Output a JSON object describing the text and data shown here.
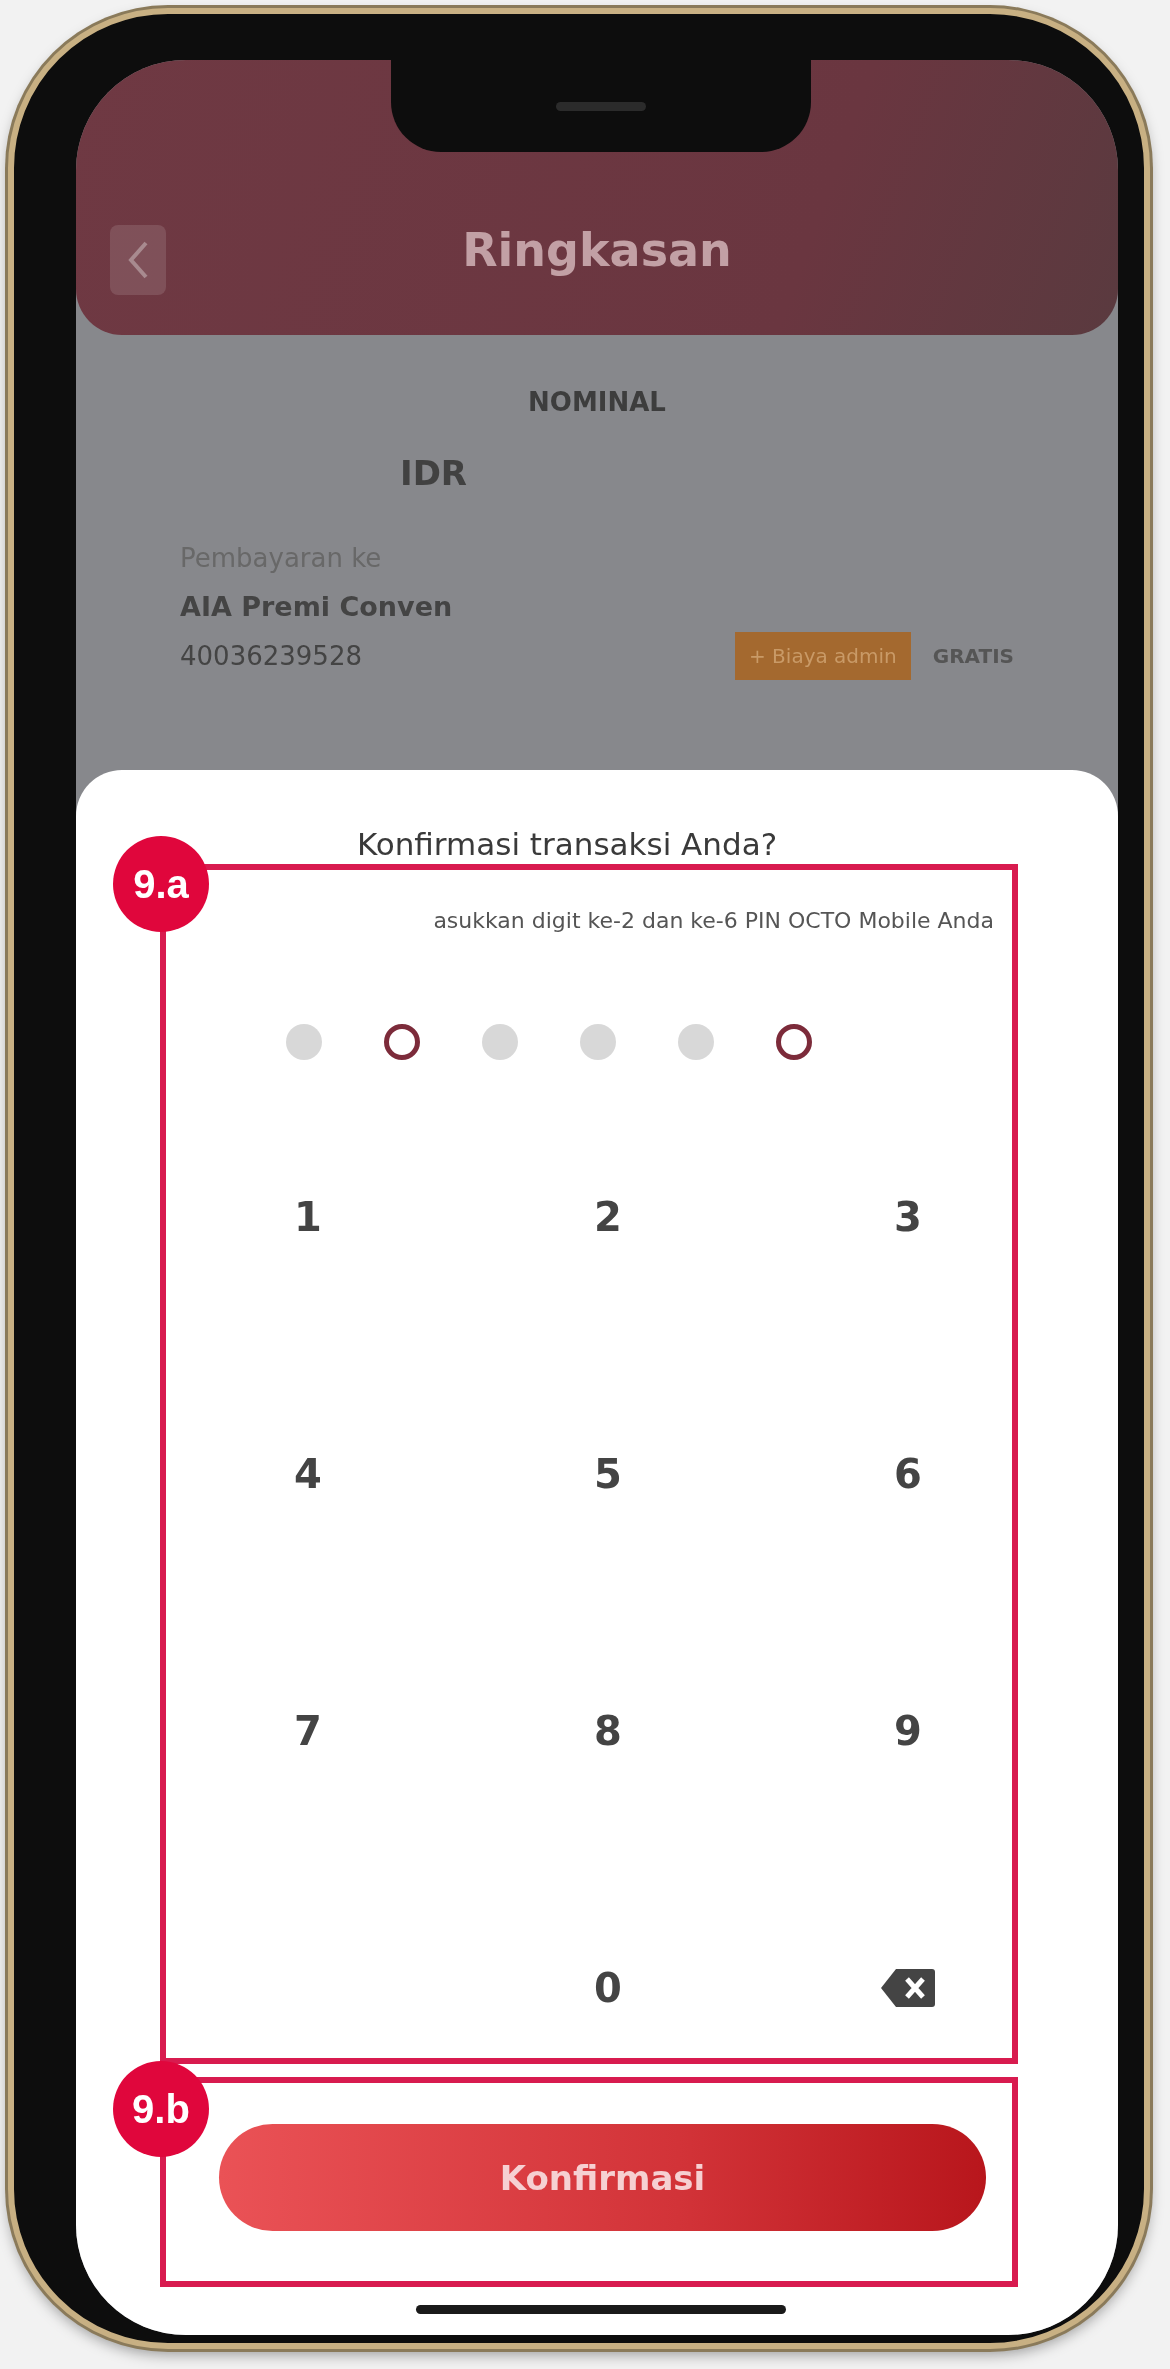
{
  "background_screen": {
    "title": "Ringkasan",
    "nominal_label": "NOMINAL",
    "currency": "IDR",
    "payment_label": "Pembayaran ke",
    "payee": "AIA Premi Conven",
    "account": "40036239528",
    "fee_badge": "+ Biaya admin",
    "fee_value": "GRATIS"
  },
  "sheet": {
    "title": "Konfirmasi transaksi Anda?",
    "instruction": "asukkan digit ke-2 dan ke-6 PIN OCTO Mobile Anda",
    "pin_digits": [
      {
        "requested": false
      },
      {
        "requested": true
      },
      {
        "requested": false
      },
      {
        "requested": false
      },
      {
        "requested": false
      },
      {
        "requested": true
      }
    ],
    "keypad": [
      {
        "kind": "digit",
        "label": "1"
      },
      {
        "kind": "digit",
        "label": "2"
      },
      {
        "kind": "digit",
        "label": "3"
      },
      {
        "kind": "digit",
        "label": "4"
      },
      {
        "kind": "digit",
        "label": "5"
      },
      {
        "kind": "digit",
        "label": "6"
      },
      {
        "kind": "digit",
        "label": "7"
      },
      {
        "kind": "digit",
        "label": "8"
      },
      {
        "kind": "digit",
        "label": "9"
      },
      {
        "kind": "empty"
      },
      {
        "kind": "digit",
        "label": "0"
      },
      {
        "kind": "backspace"
      }
    ],
    "confirm_button": "Konfirmasi"
  },
  "annotations": [
    {
      "label": "9.a"
    },
    {
      "label": "9.b"
    }
  ]
}
